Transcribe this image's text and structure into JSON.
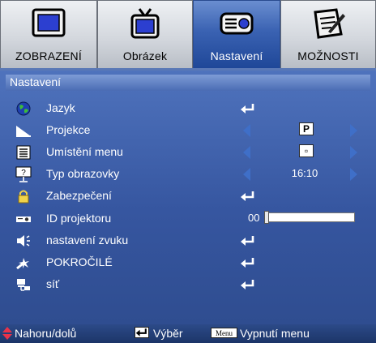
{
  "tabs": [
    {
      "label": "ZOBRAZENÍ",
      "icon": "monitor-icon",
      "active": false
    },
    {
      "label": "Obrázek",
      "icon": "tv-icon",
      "active": false
    },
    {
      "label": "Nastavení",
      "icon": "projector-icon",
      "active": true
    },
    {
      "label": "MOŽNOSTI",
      "icon": "notepad-icon",
      "active": false
    }
  ],
  "panel": {
    "title": "Nastavení",
    "items": [
      {
        "label": "Jazyk",
        "icon": "globe-icon",
        "control": "enter"
      },
      {
        "label": "Projekce",
        "icon": "projection-icon",
        "control": "select",
        "value": "P"
      },
      {
        "label": "Umístění menu",
        "icon": "menu-location-icon",
        "control": "select",
        "value": "▫"
      },
      {
        "label": "Typ obrazovky",
        "icon": "screen-type-icon",
        "control": "select",
        "value": "16:10"
      },
      {
        "label": "Zabezpečení",
        "icon": "lock-icon",
        "control": "enter"
      },
      {
        "label": "ID projektoru",
        "icon": "projector-id-icon",
        "control": "slider",
        "value": "00",
        "level": 0
      },
      {
        "label": "nastavení zvuku",
        "icon": "speaker-icon",
        "control": "enter"
      },
      {
        "label": "POKROČILÉ",
        "icon": "advanced-icon",
        "control": "enter"
      },
      {
        "label": "síť",
        "icon": "network-icon",
        "control": "enter"
      }
    ]
  },
  "footer": {
    "navigate_label": "Nahoru/dolů",
    "select_label": "Výběr",
    "menu_key": "Menu",
    "exit_label": "Vypnutí menu"
  },
  "colors": {
    "panel_bg": "#3656a0",
    "active_tab": "#3a62b2",
    "arrow": "#3f6fc8",
    "footer_bg": "#1c3568",
    "nav_arrow": "#e8334a"
  }
}
